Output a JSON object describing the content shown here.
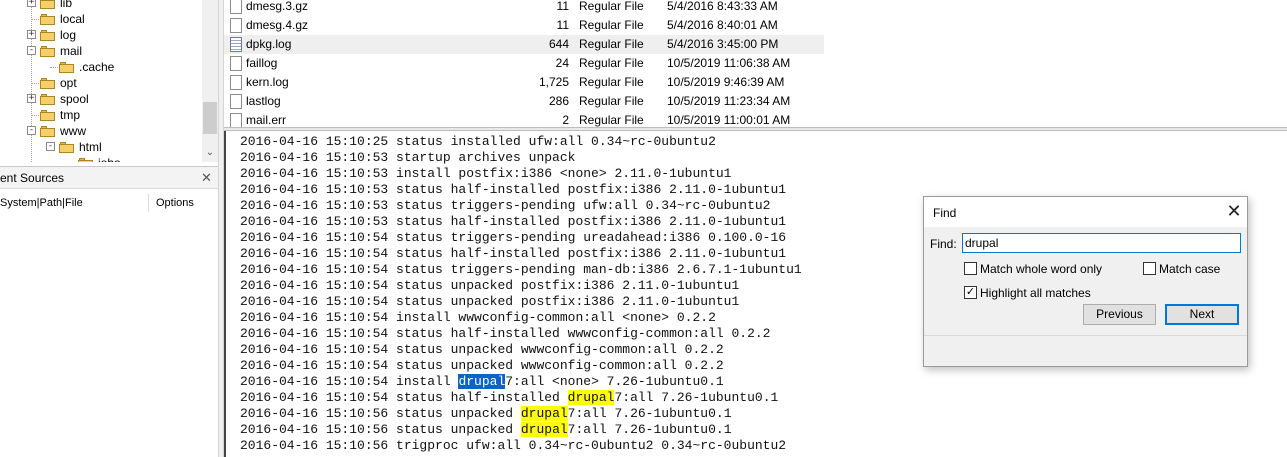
{
  "tree": {
    "items": [
      {
        "label": "lib",
        "expander": "+"
      },
      {
        "label": "local",
        "expander": ""
      },
      {
        "label": "log",
        "expander": "+"
      },
      {
        "label": "mail",
        "expander": "-"
      },
      {
        "label": ".cache",
        "expander": ""
      },
      {
        "label": "opt",
        "expander": ""
      },
      {
        "label": "spool",
        "expander": "+"
      },
      {
        "label": "tmp",
        "expander": ""
      },
      {
        "label": "www",
        "expander": "-"
      },
      {
        "label": "html",
        "expander": "-"
      },
      {
        "label": "joho",
        "expander": ""
      }
    ],
    "scroll_down": "⌄"
  },
  "sources": {
    "title": "ent Sources",
    "close": "✕",
    "columns": [
      "System|Path|File",
      "Options"
    ]
  },
  "files": [
    {
      "name": "dmesg.3.gz",
      "size": "11",
      "type": "Regular File",
      "date": "5/4/2016 8:43:33 AM",
      "icon": "file-icon"
    },
    {
      "name": "dmesg.4.gz",
      "size": "11",
      "type": "Regular File",
      "date": "5/4/2016 8:40:01 AM",
      "icon": "file-icon"
    },
    {
      "name": "dpkg.log",
      "size": "644",
      "type": "Regular File",
      "date": "5/4/2016 3:45:00 PM",
      "icon": "log-file-icon",
      "selected": true
    },
    {
      "name": "faillog",
      "size": "24",
      "type": "Regular File",
      "date": "10/5/2019 11:06:38 AM",
      "icon": "file-icon"
    },
    {
      "name": "kern.log",
      "size": "1,725",
      "type": "Regular File",
      "date": "10/5/2019 9:46:39 AM",
      "icon": "file-icon"
    },
    {
      "name": "lastlog",
      "size": "286",
      "type": "Regular File",
      "date": "10/5/2019 11:23:34 AM",
      "icon": "file-icon"
    },
    {
      "name": "mail.err",
      "size": "2",
      "type": "Regular File",
      "date": "10/5/2019 11:00:01 AM",
      "icon": "file-icon"
    }
  ],
  "log": {
    "lines": [
      {
        "pre": "2016-04-16 15:10:25 status installed ufw:all 0.34~rc-0ubuntu2"
      },
      {
        "pre": "2016-04-16 15:10:53 startup archives unpack"
      },
      {
        "pre": "2016-04-16 15:10:53 install postfix:i386 <none> 2.11.0-1ubuntu1"
      },
      {
        "pre": "2016-04-16 15:10:53 status half-installed postfix:i386 2.11.0-1ubuntu1"
      },
      {
        "pre": "2016-04-16 15:10:53 status triggers-pending ufw:all 0.34~rc-0ubuntu2"
      },
      {
        "pre": "2016-04-16 15:10:53 status half-installed postfix:i386 2.11.0-1ubuntu1"
      },
      {
        "pre": "2016-04-16 15:10:54 status triggers-pending ureadahead:i386 0.100.0-16"
      },
      {
        "pre": "2016-04-16 15:10:54 status half-installed postfix:i386 2.11.0-1ubuntu1"
      },
      {
        "pre": "2016-04-16 15:10:54 status triggers-pending man-db:i386 2.6.7.1-1ubuntu1"
      },
      {
        "pre": "2016-04-16 15:10:54 status unpacked postfix:i386 2.11.0-1ubuntu1"
      },
      {
        "pre": "2016-04-16 15:10:54 status unpacked postfix:i386 2.11.0-1ubuntu1"
      },
      {
        "pre": "2016-04-16 15:10:54 install wwwconfig-common:all <none> 0.2.2"
      },
      {
        "pre": "2016-04-16 15:10:54 status half-installed wwwconfig-common:all 0.2.2"
      },
      {
        "pre": "2016-04-16 15:10:54 status unpacked wwwconfig-common:all 0.2.2"
      },
      {
        "pre": "2016-04-16 15:10:54 status unpacked wwwconfig-common:all 0.2.2"
      },
      {
        "pre": "2016-04-16 15:10:54 install ",
        "match": "drupal",
        "post": "7:all <none> 7.26-1ubuntu0.1",
        "current": true
      },
      {
        "pre": "2016-04-16 15:10:54 status half-installed ",
        "match": "drupal",
        "post": "7:all 7.26-1ubuntu0.1"
      },
      {
        "pre": "2016-04-16 15:10:56 status unpacked ",
        "match": "drupal",
        "post": "7:all 7.26-1ubuntu0.1"
      },
      {
        "pre": "2016-04-16 15:10:56 status unpacked ",
        "match": "drupal",
        "post": "7:all 7.26-1ubuntu0.1"
      },
      {
        "pre": "2016-04-16 15:10:56 trigproc ufw:all 0.34~rc-0ubuntu2 0.34~rc-0ubuntu2"
      }
    ],
    "highlight_color": "#ffff00",
    "current_color": "#0a64c8"
  },
  "find_dialog": {
    "title": "Find",
    "close": "✕",
    "find_label": "Find:",
    "query": "drupal",
    "match_whole_word": {
      "label": "Match whole word only",
      "checked": false
    },
    "match_case": {
      "label": "Match case",
      "checked": false
    },
    "highlight_all": {
      "label": "Highlight all matches",
      "checked": true
    },
    "previous_label": "Previous",
    "next_label": "Next"
  }
}
